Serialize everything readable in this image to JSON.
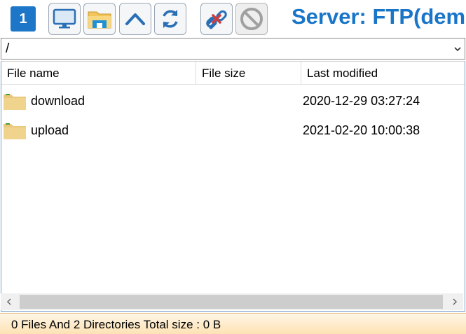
{
  "toolbar": {
    "tab_number": "1",
    "server_title": "Server:  FTP(dem"
  },
  "path": {
    "value": "/"
  },
  "columns": [
    "File name",
    "File size",
    "Last modified"
  ],
  "files": [
    {
      "name": "download",
      "size": "",
      "modified": "2020-12-29 03:27:24"
    },
    {
      "name": "upload",
      "size": "",
      "modified": "2021-02-20 10:00:38"
    }
  ],
  "status": {
    "text": "0 Files And 2 Directories Total size : 0 B"
  },
  "colors": {
    "accent": "#1875c8",
    "folder": "#e9c77b",
    "disconnect_red": "#d23c3c"
  }
}
